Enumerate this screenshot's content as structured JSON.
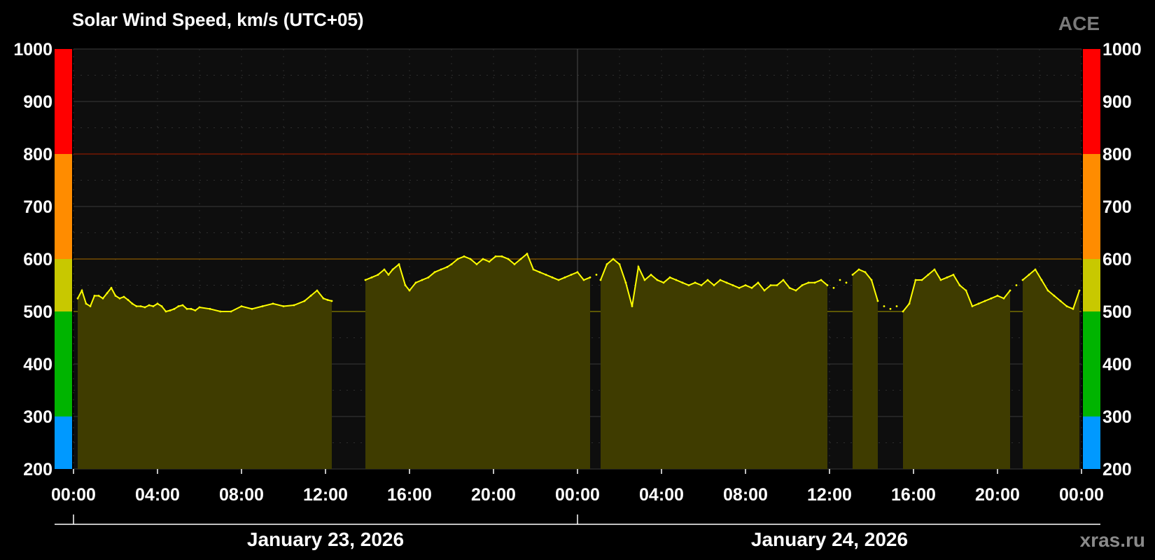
{
  "header": {
    "title": "Solar Wind Speed, km/s (UTC+05)",
    "source_label": "ACE",
    "watermark": "xras.ru"
  },
  "chart_data": {
    "type": "area",
    "title": "Solar Wind Speed, km/s (UTC+05)",
    "xlabel": "",
    "ylabel": "",
    "ylim": [
      200,
      1000
    ],
    "xlim_hours": [
      0,
      48
    ],
    "y_ticks": [
      200,
      300,
      400,
      500,
      600,
      700,
      800,
      900,
      1000
    ],
    "x_tick_labels": [
      "00:00",
      "04:00",
      "08:00",
      "12:00",
      "16:00",
      "20:00",
      "00:00",
      "04:00",
      "08:00",
      "12:00",
      "16:00",
      "20:00",
      "00:00"
    ],
    "x_tick_hours": [
      0,
      4,
      8,
      12,
      16,
      20,
      24,
      28,
      32,
      36,
      40,
      44,
      48
    ],
    "date_labels": [
      {
        "text": "January 23, 2026",
        "center_hour": 12
      },
      {
        "text": "January 24, 2026",
        "center_hour": 36
      }
    ],
    "grid": true,
    "legend": "none",
    "thresholds": [
      {
        "value": 500,
        "color": "#8c8200"
      },
      {
        "value": 600,
        "color": "#8c5a00"
      },
      {
        "value": 800,
        "color": "#8c1a00"
      }
    ],
    "color_scale": [
      {
        "from": 200,
        "to": 300,
        "color": "#0099ff"
      },
      {
        "from": 300,
        "to": 500,
        "color": "#00b400"
      },
      {
        "from": 500,
        "to": 600,
        "color": "#c8c800"
      },
      {
        "from": 600,
        "to": 800,
        "color": "#ff8c00"
      },
      {
        "from": 800,
        "to": 1000,
        "color": "#ff0000"
      }
    ],
    "series": [
      {
        "color": "#ffff00",
        "fill": "#3f3c00",
        "x_hours": [
          0.2,
          0.4,
          0.6,
          0.8,
          1.0,
          1.2,
          1.4,
          1.6,
          1.8,
          2.0,
          2.2,
          2.4,
          2.6,
          2.8,
          3.0,
          3.2,
          3.4,
          3.6,
          3.8,
          4.0,
          4.2,
          4.4,
          4.6,
          4.8,
          5.0,
          5.2,
          5.4,
          5.6,
          5.8,
          6.0,
          6.5,
          7.0,
          7.5,
          8.0,
          8.5,
          9.0,
          9.5,
          10.0,
          10.5,
          11.0,
          11.3,
          11.6,
          11.9,
          12.1,
          12.3,
          13.9,
          14.2,
          14.5,
          14.8,
          15.0,
          15.2,
          15.5,
          15.8,
          16.0,
          16.3,
          16.6,
          16.9,
          17.2,
          17.5,
          17.8,
          18.0,
          18.3,
          18.6,
          18.9,
          19.2,
          19.5,
          19.8,
          20.1,
          20.4,
          20.7,
          21.0,
          21.3,
          21.6,
          21.9,
          22.2,
          22.5,
          22.8,
          23.1,
          23.4,
          23.7,
          24.0,
          24.3,
          24.6,
          24.9,
          25.1,
          25.4,
          25.7,
          26.0,
          26.3,
          26.6,
          26.9,
          27.2,
          27.5,
          27.8,
          28.1,
          28.4,
          28.7,
          29.0,
          29.3,
          29.6,
          29.9,
          30.2,
          30.5,
          30.8,
          31.1,
          31.4,
          31.7,
          32.0,
          32.3,
          32.6,
          32.9,
          33.2,
          33.5,
          33.8,
          34.1,
          34.4,
          34.7,
          35.0,
          35.3,
          35.6,
          35.9,
          36.2,
          36.5,
          36.8,
          37.1,
          37.4,
          37.7,
          38.0,
          38.3,
          38.6,
          38.9,
          39.2,
          39.5,
          39.8,
          40.1,
          40.4,
          40.7,
          41.0,
          41.3,
          41.6,
          41.9,
          42.2,
          42.5,
          42.8,
          43.1,
          43.4,
          43.7,
          44.0,
          44.3,
          44.6,
          44.9,
          45.2,
          45.5,
          45.8,
          46.1,
          46.4,
          46.7,
          47.0,
          47.3,
          47.6,
          47.9
        ],
        "values": [
          525,
          540,
          515,
          510,
          530,
          530,
          525,
          535,
          545,
          530,
          525,
          528,
          522,
          515,
          510,
          510,
          508,
          512,
          510,
          515,
          510,
          500,
          502,
          505,
          510,
          512,
          505,
          505,
          502,
          508,
          505,
          500,
          500,
          510,
          505,
          510,
          515,
          510,
          512,
          520,
          530,
          540,
          525,
          522,
          520,
          560,
          565,
          570,
          580,
          570,
          580,
          590,
          550,
          540,
          555,
          560,
          565,
          575,
          580,
          585,
          590,
          600,
          605,
          600,
          590,
          600,
          595,
          605,
          605,
          600,
          590,
          600,
          610,
          580,
          575,
          570,
          565,
          560,
          565,
          570,
          575,
          560,
          565,
          570,
          560,
          590,
          600,
          590,
          555,
          510,
          585,
          560,
          570,
          560,
          555,
          565,
          560,
          555,
          550,
          555,
          550,
          560,
          550,
          560,
          555,
          550,
          545,
          550,
          545,
          555,
          540,
          550,
          550,
          560,
          545,
          540,
          550,
          555,
          555,
          560,
          550,
          545,
          560,
          555,
          570,
          580,
          575,
          560,
          520,
          510,
          505,
          510,
          500,
          515,
          560,
          560,
          570,
          580,
          560,
          565,
          570,
          550,
          540,
          510,
          515,
          520,
          525,
          530,
          525,
          540,
          550,
          560,
          570,
          580,
          560,
          540,
          530,
          520,
          510,
          505,
          540
        ]
      }
    ],
    "segments_hours": [
      [
        0.2,
        12.3
      ],
      [
        13.8,
        24.8
      ],
      [
        25.0,
        36.0
      ],
      [
        37.0,
        38.5
      ],
      [
        39.3,
        44.8
      ],
      [
        45.0,
        47.9
      ]
    ]
  }
}
